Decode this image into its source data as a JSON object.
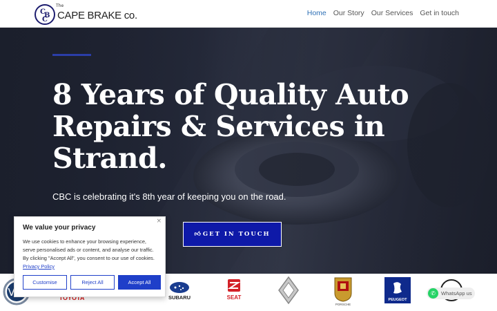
{
  "header": {
    "logo": {
      "mark": [
        "C",
        "B",
        "C"
      ],
      "the": "The",
      "text": "CAPE BRAKE co."
    },
    "nav": [
      {
        "label": "Home",
        "active": true
      },
      {
        "label": "Our Story",
        "active": false
      },
      {
        "label": "Our Services",
        "active": false
      },
      {
        "label": "Get in touch",
        "active": false
      }
    ]
  },
  "hero": {
    "title_lines": [
      "8 Years of Quality Auto",
      "Repairs & Services in",
      "Strand."
    ],
    "subtitle": "CBC is celebrating it's 8th year of keeping you on the road.",
    "cta_label": "GET IN TOUCH",
    "cta_icon": "thumbs-up-icon"
  },
  "brands": [
    {
      "name": "volkswagen",
      "label": ""
    },
    {
      "name": "toyota",
      "label": "TOYOTA"
    },
    {
      "name": "subaru",
      "label": "SUBARU"
    },
    {
      "name": "seat",
      "label": "SEAT"
    },
    {
      "name": "renault",
      "label": ""
    },
    {
      "name": "porsche",
      "label": "PORSCHE"
    },
    {
      "name": "peugeot",
      "label": "PEUGEOT"
    },
    {
      "name": "ford",
      "label": ""
    }
  ],
  "cookie": {
    "title": "We value your privacy",
    "body": "We use cookies to enhance your browsing experience, serve personalised ads or content, and analyse our traffic. By clicking \"Accept All\", you consent to our use of cookies.",
    "link": "Privacy Policy",
    "buttons": {
      "customise": "Customise",
      "reject": "Reject All",
      "accept": "Accept All"
    },
    "close": "×"
  },
  "whatsapp": {
    "label": "WhatsApp us"
  },
  "colors": {
    "accent": "#0e19a8",
    "nav_active": "#2d6fb5",
    "cookie_blue": "#1f3fc9"
  }
}
